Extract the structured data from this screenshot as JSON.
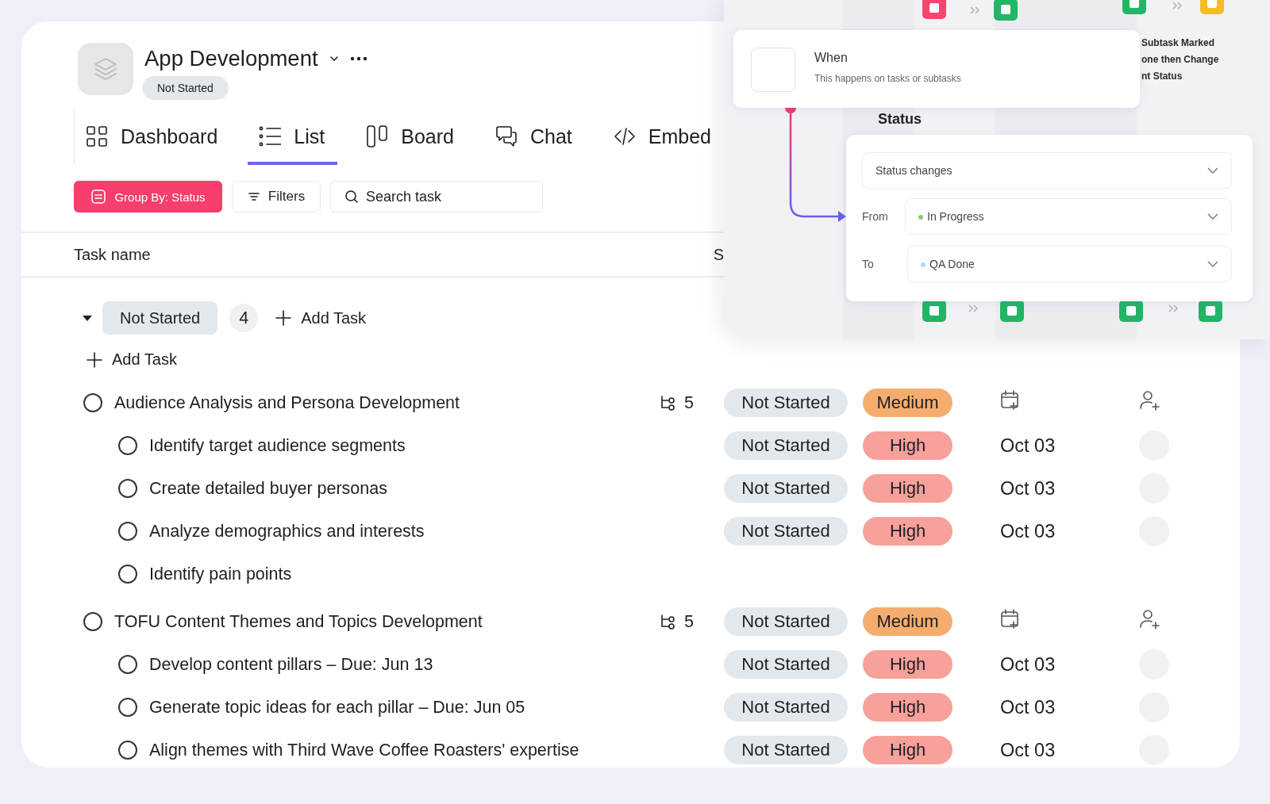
{
  "project": {
    "title": "App Development",
    "status": "Not Started"
  },
  "tabs": [
    {
      "label": "Dashboard",
      "selected": false
    },
    {
      "label": "List",
      "selected": true
    },
    {
      "label": "Board",
      "selected": false
    },
    {
      "label": "Chat",
      "selected": false
    },
    {
      "label": "Embed",
      "selected": false
    }
  ],
  "toolbar": {
    "group_by": "Group By: Status",
    "filters": "Filters",
    "search": {
      "placeholder": "Search task"
    }
  },
  "table": {
    "columns": [
      "Task name",
      "S"
    ]
  },
  "group": {
    "status": "Not Started",
    "count": "4",
    "add_task": "Add Task",
    "expanded": true
  },
  "add_task": "Add Task",
  "tasks": [
    {
      "name": "Audience Analysis and Persona Development",
      "checked": false,
      "subtask_count": "5",
      "status": "Not Started",
      "priority": {
        "label": "Medium",
        "color": "#f5ad6f"
      },
      "children": [
        {
          "name": "Identify target audience segments",
          "checked": false,
          "status": "Not Started",
          "priority": {
            "label": "High",
            "color": "#f8a09a"
          },
          "due": "Oct 03"
        },
        {
          "name": "Create detailed buyer personas",
          "checked": false,
          "status": "Not Started",
          "priority": {
            "label": "High",
            "color": "#f8a09a"
          },
          "due": "Oct 03"
        },
        {
          "name": "Analyze demographics and interests",
          "checked": false,
          "status": "Not Started",
          "priority": {
            "label": "High",
            "color": "#f8a09a"
          },
          "due": "Oct 03"
        },
        {
          "name": "Identify pain points",
          "checked": false
        }
      ]
    },
    {
      "name": "TOFU Content Themes and Topics Development",
      "checked": false,
      "subtask_count": "5",
      "status": "Not Started",
      "priority": {
        "label": "Medium",
        "color": "#f5ad6f"
      },
      "children": [
        {
          "name": "Develop content pillars – Due: Jun 13",
          "checked": false,
          "status": "Not Started",
          "priority": {
            "label": "High",
            "color": "#f8a09a"
          },
          "due": "Oct 03"
        },
        {
          "name": "Generate topic ideas for each pillar – Due: Jun 05",
          "checked": false,
          "status": "Not Started",
          "priority": {
            "label": "High",
            "color": "#f8a09a"
          },
          "due": "Oct 03"
        },
        {
          "name": "Align themes with Third Wave Coffee Roasters' expertise",
          "checked": false,
          "status": "Not Started",
          "priority": {
            "label": "High",
            "color": "#f8a09a"
          },
          "due": "Oct 03"
        }
      ]
    }
  ],
  "automation": {
    "background_text": [
      "Subtask Marked",
      "one then Change",
      "nt Status"
    ],
    "trigger": {
      "title": "When",
      "description": "This happens on tasks or subtasks"
    },
    "section_label": "Status",
    "event": "Status changes",
    "from": {
      "label": "From",
      "value": "In Progress",
      "color": "#7ed36b"
    },
    "to": {
      "label": "To",
      "value": "QA Done",
      "color": "#a6daf7"
    }
  }
}
